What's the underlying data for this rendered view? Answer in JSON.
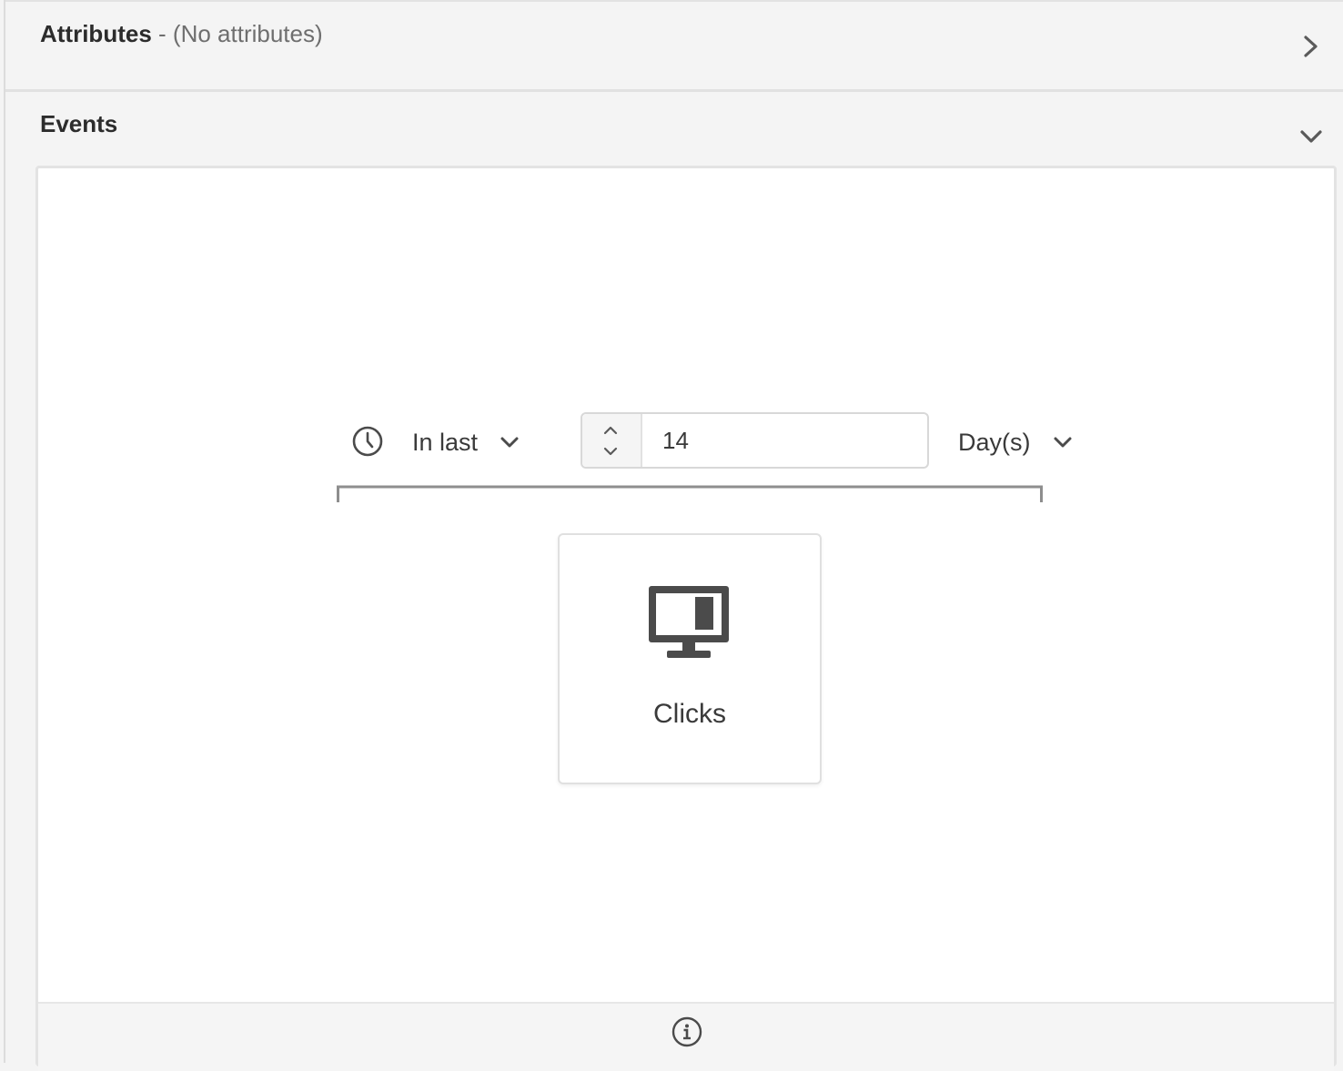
{
  "attributes": {
    "title": "Attributes",
    "separator": "-",
    "summary": "(No attributes)",
    "expand_icon": "chevron-right-icon"
  },
  "events": {
    "title": "Events",
    "collapse_icon": "chevron-down-icon",
    "time_filter": {
      "clock_icon": "clock-icon",
      "operator": "In last",
      "value": "14",
      "unit": "Day(s)"
    },
    "event_tile": {
      "icon": "monitor-icon",
      "label": "Clicks"
    },
    "footer": {
      "info_icon": "info-icon"
    }
  },
  "colors": {
    "panel_bg": "#f4f4f4",
    "card_bg": "#ffffff",
    "icon_dark": "#4b4b4b",
    "text": "#2c2c2c"
  }
}
